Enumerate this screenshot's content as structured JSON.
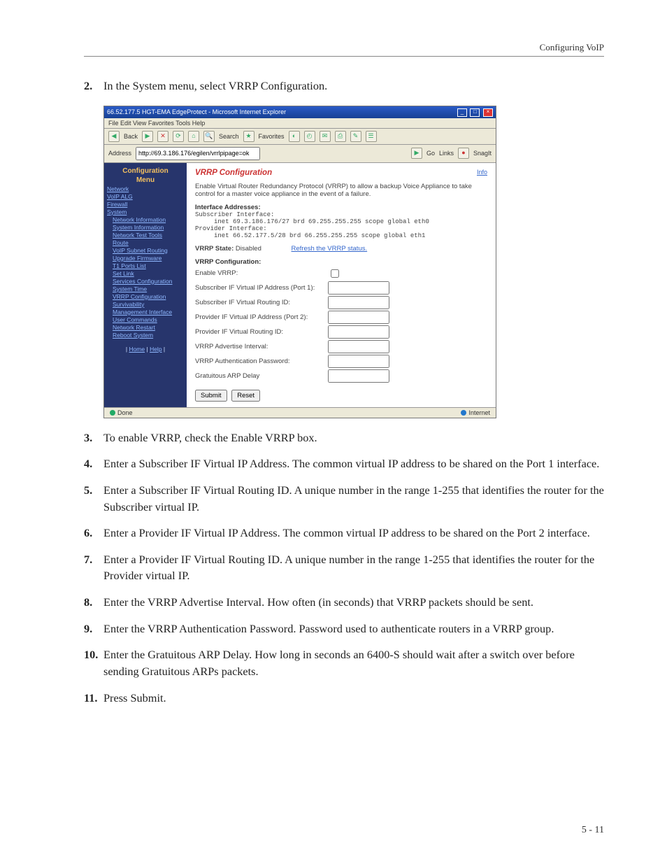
{
  "header": {
    "running": "Configuring VoIP"
  },
  "steps": {
    "s2": "In the System menu, select VRRP Configuration.",
    "s3": "To enable VRRP, check the Enable VRRP box.",
    "s4": "Enter a Subscriber IF Virtual IP Address. The common virtual IP address to be shared on the Port 1 interface.",
    "s5": "Enter a Subscriber IF Virtual Routing ID. A unique number in the range 1-255 that identifies the router for the Subscriber virtual IP.",
    "s6": "Enter a Provider IF Virtual IP Address. The common virtual IP address to be shared on the Port 2 interface.",
    "s7": "Enter a Provider IF Virtual Routing ID. A unique number in the range 1-255 that identifies the router for the Provider virtual IP.",
    "s8": "Enter the VRRP Advertise Interval. How often (in seconds) that VRRP packets should be sent.",
    "s9": "Enter the VRRP Authentication Password. Password used to authenticate routers in a VRRP group.",
    "s10": "Enter the Gratuitous ARP Delay. How long in seconds an 6400-S should wait after a switch over before sending Gratuitous ARPs packets.",
    "s11": "Press Submit."
  },
  "nums": {
    "n2": "2.",
    "n3": "3.",
    "n4": "4.",
    "n5": "5.",
    "n6": "6.",
    "n7": "7.",
    "n8": "8.",
    "n9": "9.",
    "n10": "10.",
    "n11": "11."
  },
  "ie": {
    "title": "66.52.177.5 HGT-EMA EdgeProtect - Microsoft Internet Explorer",
    "menu": "File   Edit   View   Favorites   Tools   Help",
    "back": "Back",
    "search": "Search",
    "fav": "Favorites",
    "addr_label": "Address",
    "addr_value": "http://69.3.186.176/egilen/vrrlpipage=ok",
    "go": "Go",
    "links": "Links",
    "snagit": "SnagIt",
    "status_done": "Done",
    "status_zone": "Internet"
  },
  "sidebar": {
    "hdr1": "Configuration",
    "hdr2": "Menu",
    "items": [
      "Network",
      "VoIP ALG",
      "Firewall",
      "System"
    ],
    "sub": [
      "Network Information",
      "System Information",
      "Network Test Tools",
      "Route",
      "VoIP Subnet Routing",
      "Upgrade Firmware",
      "T1 Ports List",
      "Set Link",
      "Services Configuration",
      "System Time",
      "VRRP Configuration",
      "Survivability",
      "Management Interface",
      "User Commands",
      "Network Restart",
      "Reboot System"
    ],
    "footer": [
      "Home",
      "Help"
    ]
  },
  "panel": {
    "title": "VRRP Configuration",
    "info": "Info",
    "intro": "Enable Virtual Router Redundancy Protocol (VRRP) to allow a backup Voice Appliance to take control for a master voice appliance in the event of a failure.",
    "addr_head": "Interface Addresses:",
    "sub_if": "Subscriber Interface:",
    "sub_line": "     inet 69.3.186.176/27 brd 69.255.255.255 scope global eth0",
    "prov_if": "Provider Interface:",
    "prov_line": "     inet 66.52.177.5/28 brd 66.255.255.255 scope global eth1",
    "state_label": "VRRP State:",
    "state_value": "Disabled",
    "refresh": "Refresh the VRRP status.",
    "cfg_head": "VRRP Configuration:",
    "f_enable": "Enable VRRP:",
    "f_subip": "Subscriber IF Virtual IP Address (Port 1):",
    "f_subrid": "Subscriber IF Virtual Routing ID:",
    "f_provip": "Provider IF Virtual IP Address (Port 2):",
    "f_provrid": "Provider IF Virtual Routing ID:",
    "f_adv": "VRRP Advertise Interval:",
    "f_auth": "VRRP Authentication Password:",
    "f_garp": "Gratuitous ARP Delay",
    "submit": "Submit",
    "reset": "Reset"
  },
  "page_num": "5 - 11"
}
